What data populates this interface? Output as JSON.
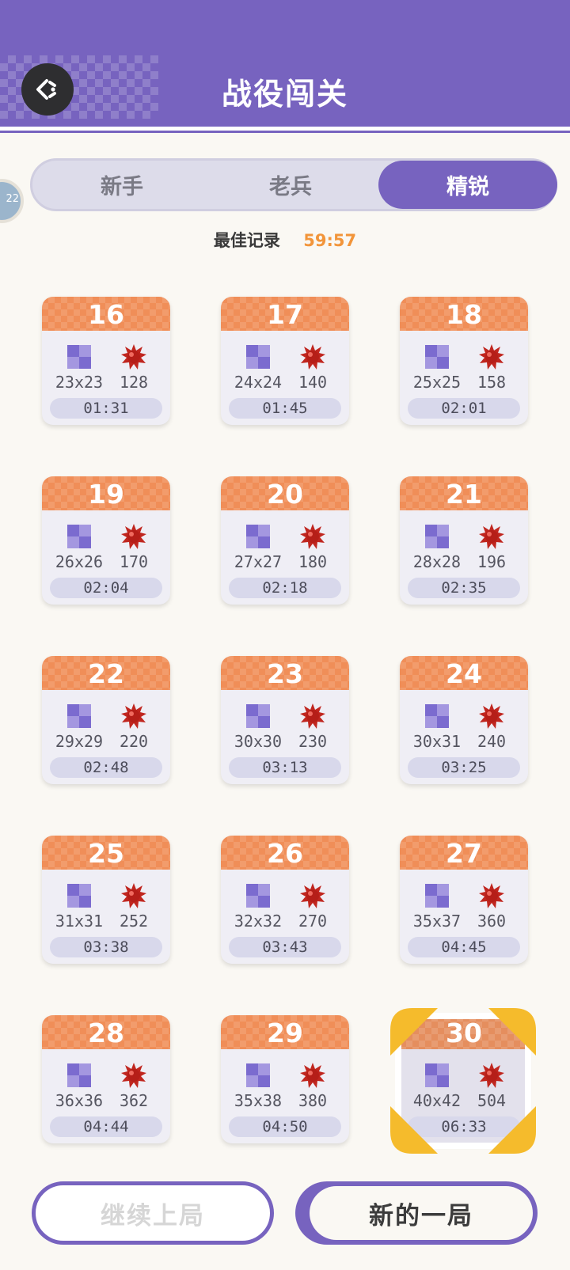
{
  "header": {
    "title": "战役闯关"
  },
  "tabs": [
    {
      "label": "新手",
      "active": false
    },
    {
      "label": "老兵",
      "active": false
    },
    {
      "label": "精锐",
      "active": true
    }
  ],
  "best_record": {
    "label": "最佳记录",
    "value": "59:57"
  },
  "side_avatar": {
    "text": "22"
  },
  "colors": {
    "accent": "#7763BF",
    "card_header": "#F08E58",
    "record_value": "#F2953A",
    "mine": "#C0261F"
  },
  "levels": [
    {
      "number": "16",
      "size": "23x23",
      "mines": "128",
      "time": "01:31"
    },
    {
      "number": "17",
      "size": "24x24",
      "mines": "140",
      "time": "01:45"
    },
    {
      "number": "18",
      "size": "25x25",
      "mines": "158",
      "time": "02:01"
    },
    {
      "number": "19",
      "size": "26x26",
      "mines": "170",
      "time": "02:04"
    },
    {
      "number": "20",
      "size": "27x27",
      "mines": "180",
      "time": "02:18"
    },
    {
      "number": "21",
      "size": "28x28",
      "mines": "196",
      "time": "02:35"
    },
    {
      "number": "22",
      "size": "29x29",
      "mines": "220",
      "time": "02:48"
    },
    {
      "number": "23",
      "size": "30x30",
      "mines": "230",
      "time": "03:13"
    },
    {
      "number": "24",
      "size": "30x31",
      "mines": "240",
      "time": "03:25"
    },
    {
      "number": "25",
      "size": "31x31",
      "mines": "252",
      "time": "03:38"
    },
    {
      "number": "26",
      "size": "32x32",
      "mines": "270",
      "time": "03:43"
    },
    {
      "number": "27",
      "size": "35x37",
      "mines": "360",
      "time": "04:45"
    },
    {
      "number": "28",
      "size": "36x36",
      "mines": "362",
      "time": "04:44"
    },
    {
      "number": "29",
      "size": "35x38",
      "mines": "380",
      "time": "04:50"
    },
    {
      "number": "30",
      "size": "40x42",
      "mines": "504",
      "time": "06:33",
      "selected": true
    }
  ],
  "buttons": {
    "continue_label": "继续上局",
    "new_game_label": "新的一局"
  }
}
